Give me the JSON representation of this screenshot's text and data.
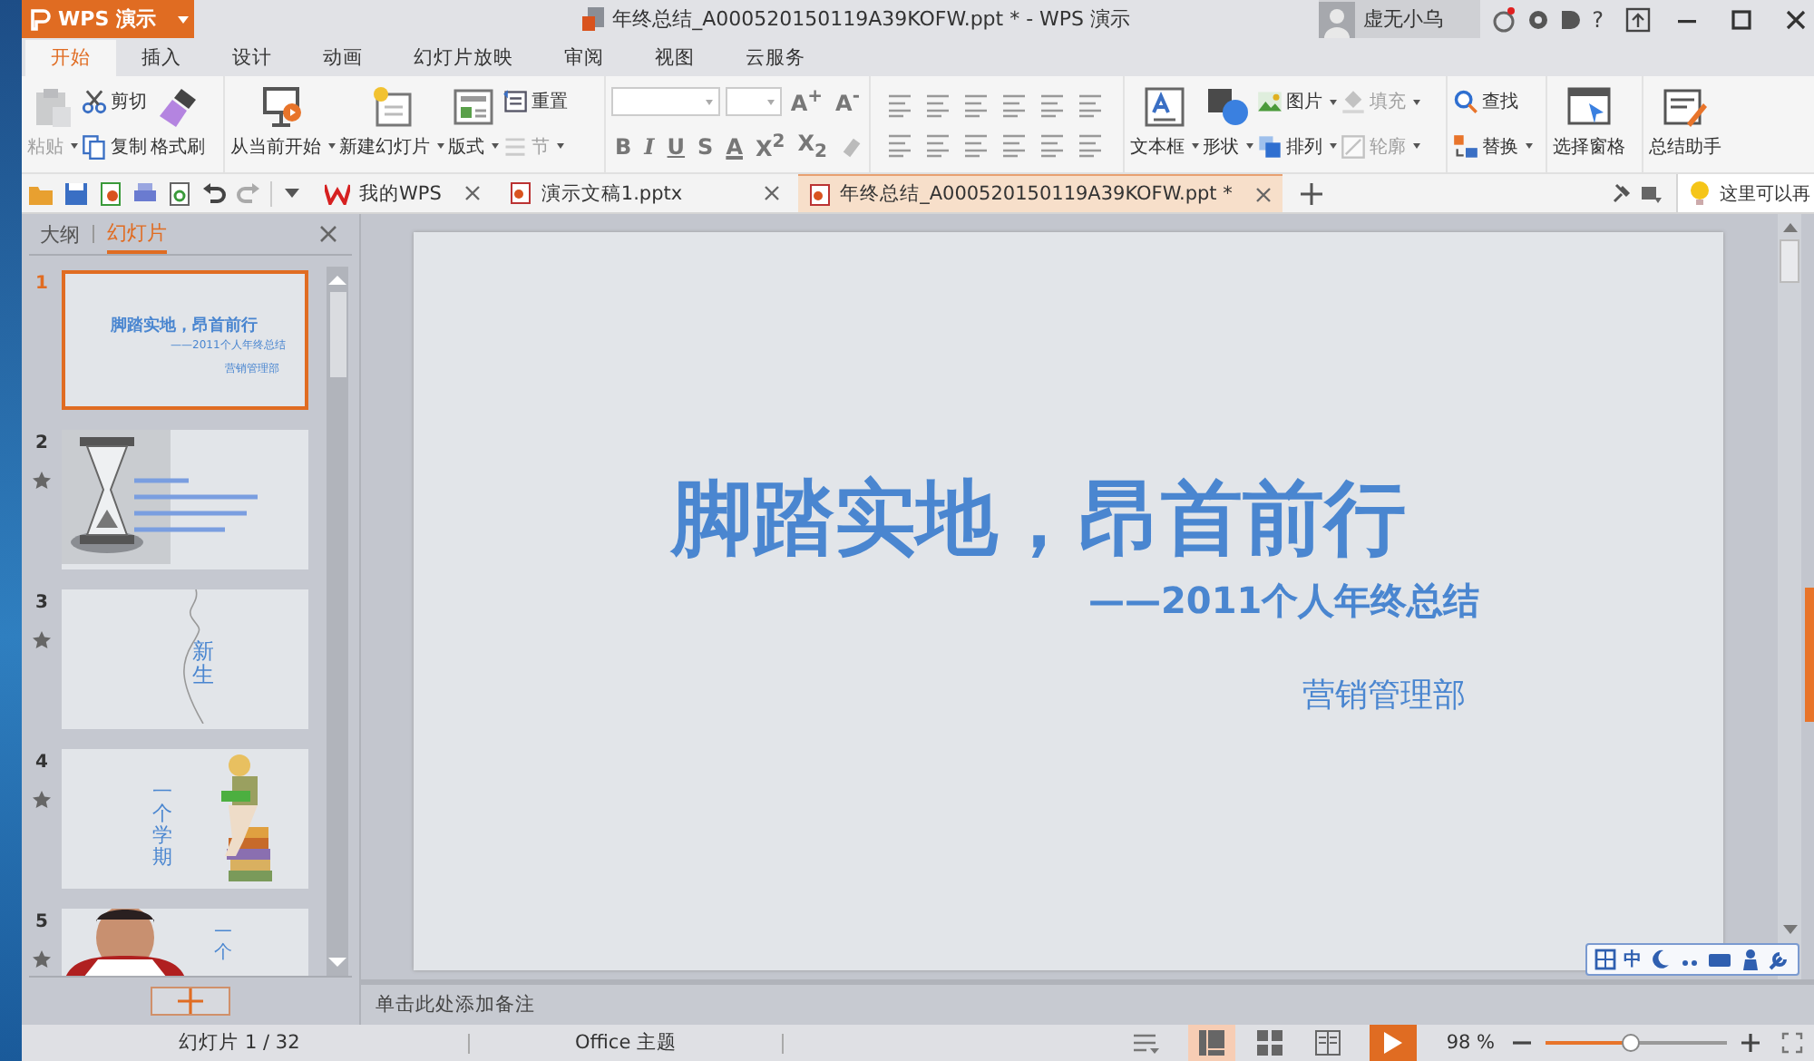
{
  "title_bar": {
    "app_button": "WPS 演示",
    "title": "年终总结_A000520150119A39KOFW.ppt * - WPS 演示",
    "user_name": "虚无小乌",
    "help": "?"
  },
  "menu_tabs": [
    {
      "label": "开始",
      "selected": true
    },
    {
      "label": "插入",
      "selected": false
    },
    {
      "label": "设计",
      "selected": false
    },
    {
      "label": "动画",
      "selected": false
    },
    {
      "label": "幻灯片放映",
      "selected": false
    },
    {
      "label": "审阅",
      "selected": false
    },
    {
      "label": "视图",
      "selected": false
    },
    {
      "label": "云服务",
      "selected": false
    }
  ],
  "ribbon": {
    "groups": [
      {
        "kind": "columns",
        "columns": [
          [
            {
              "label": "粘贴",
              "kind": "large",
              "dropdown": true,
              "disabled": true
            }
          ],
          [
            {
              "label": "剪切",
              "kind": "small",
              "dropdown": false,
              "disabled": false
            },
            {
              "label": "复制",
              "kind": "small",
              "dropdown": false,
              "disabled": false
            }
          ],
          [
            {
              "label": "格式刷",
              "kind": "large",
              "dropdown": false,
              "disabled": false
            }
          ]
        ]
      },
      {
        "kind": "columns",
        "columns": [
          [
            {
              "label": "从当前开始",
              "kind": "large",
              "dropdown": true,
              "disabled": false
            }
          ],
          [
            {
              "label": "新建幻灯片",
              "kind": "large",
              "dropdown": true,
              "disabled": false
            }
          ],
          [
            {
              "label": "版式",
              "kind": "large",
              "dropdown": true,
              "disabled": false
            }
          ],
          [
            {
              "label": "重置",
              "kind": "small",
              "dropdown": false,
              "disabled": false
            },
            {
              "label": "节",
              "kind": "small",
              "dropdown": true,
              "disabled": true
            }
          ]
        ]
      },
      {
        "kind": "font",
        "size_buttons": [
          "A$^{+}$",
          "A$^{-}$"
        ],
        "format_buttons": [
          "B",
          "I",
          "U",
          "S",
          "A",
          "X$^{2}$",
          "X$_{2}$"
        ]
      },
      {
        "kind": "paragraph"
      },
      {
        "kind": "columns",
        "columns": [
          [
            {
              "label": "文本框",
              "kind": "large",
              "dropdown": true,
              "disabled": false
            }
          ],
          [
            {
              "label": "形状",
              "kind": "large",
              "dropdown": true,
              "disabled": false
            }
          ],
          [
            {
              "label": "图片",
              "kind": "small",
              "dropdown": true,
              "disabled": false
            },
            {
              "label": "排列",
              "kind": "small",
              "dropdown": true,
              "disabled": false
            }
          ],
          [
            {
              "label": "填充",
              "kind": "small",
              "dropdown": true,
              "disabled": true
            },
            {
              "label": "轮廓",
              "kind": "small",
              "dropdown": true,
              "disabled": true
            }
          ]
        ]
      },
      {
        "kind": "columns",
        "columns": [
          [
            {
              "label": "查找",
              "kind": "small",
              "dropdown": false,
              "disabled": false
            },
            {
              "label": "替换",
              "kind": "small",
              "dropdown": true,
              "disabled": false
            }
          ]
        ]
      },
      {
        "kind": "columns",
        "columns": [
          [
            {
              "label": "选择窗格",
              "kind": "large",
              "dropdown": false,
              "disabled": false
            }
          ]
        ]
      },
      {
        "kind": "columns",
        "columns": [
          [
            {
              "label": "总结助手",
              "kind": "large",
              "dropdown": false,
              "disabled": false
            }
          ]
        ]
      }
    ]
  },
  "doc_tabs": [
    {
      "label": "我的WPS",
      "kind": "home",
      "selected": false
    },
    {
      "label": "演示文稿1.pptx",
      "kind": "file",
      "selected": false
    },
    {
      "label": "年终总结_A000520150119A39KOFW.ppt *",
      "kind": "file",
      "selected": true
    }
  ],
  "tip": "这里可以再",
  "side_panel": {
    "tabs": [
      {
        "label": "大纲",
        "selected": false
      },
      {
        "label": "幻灯片",
        "selected": true
      }
    ],
    "slides": [
      {
        "number": "1",
        "selected": true,
        "animated": false,
        "kind": "title",
        "title": "脚踏实地，昂首前行",
        "subtitle": "——2011个人年终总结",
        "note": "营销管理部"
      },
      {
        "number": "2",
        "selected": false,
        "animated": true,
        "kind": "hourglass"
      },
      {
        "number": "3",
        "selected": false,
        "animated": true,
        "kind": "vertical",
        "text": "新生"
      },
      {
        "number": "4",
        "selected": false,
        "animated": true,
        "kind": "reader",
        "text": "一个学期"
      },
      {
        "number": "5",
        "selected": false,
        "animated": true,
        "kind": "figure",
        "text": "一个"
      }
    ]
  },
  "slide": {
    "title": "脚踏实地，昂首前行",
    "subtitle": "——2011个人年终总结",
    "department": "营销管理部"
  },
  "notes_placeholder": "单击此处添加备注",
  "ime_toolbar": {
    "mode": "中"
  },
  "status_bar": {
    "slide_count": "幻灯片 1 / 32",
    "theme": "Office 主题",
    "views": [
      {
        "kind": "normal",
        "selected": true
      },
      {
        "kind": "sorter",
        "selected": false
      },
      {
        "kind": "reading",
        "selected": false
      }
    ],
    "zoom": "98 %",
    "zoom_slider": {
      "level": 0.47
    }
  }
}
